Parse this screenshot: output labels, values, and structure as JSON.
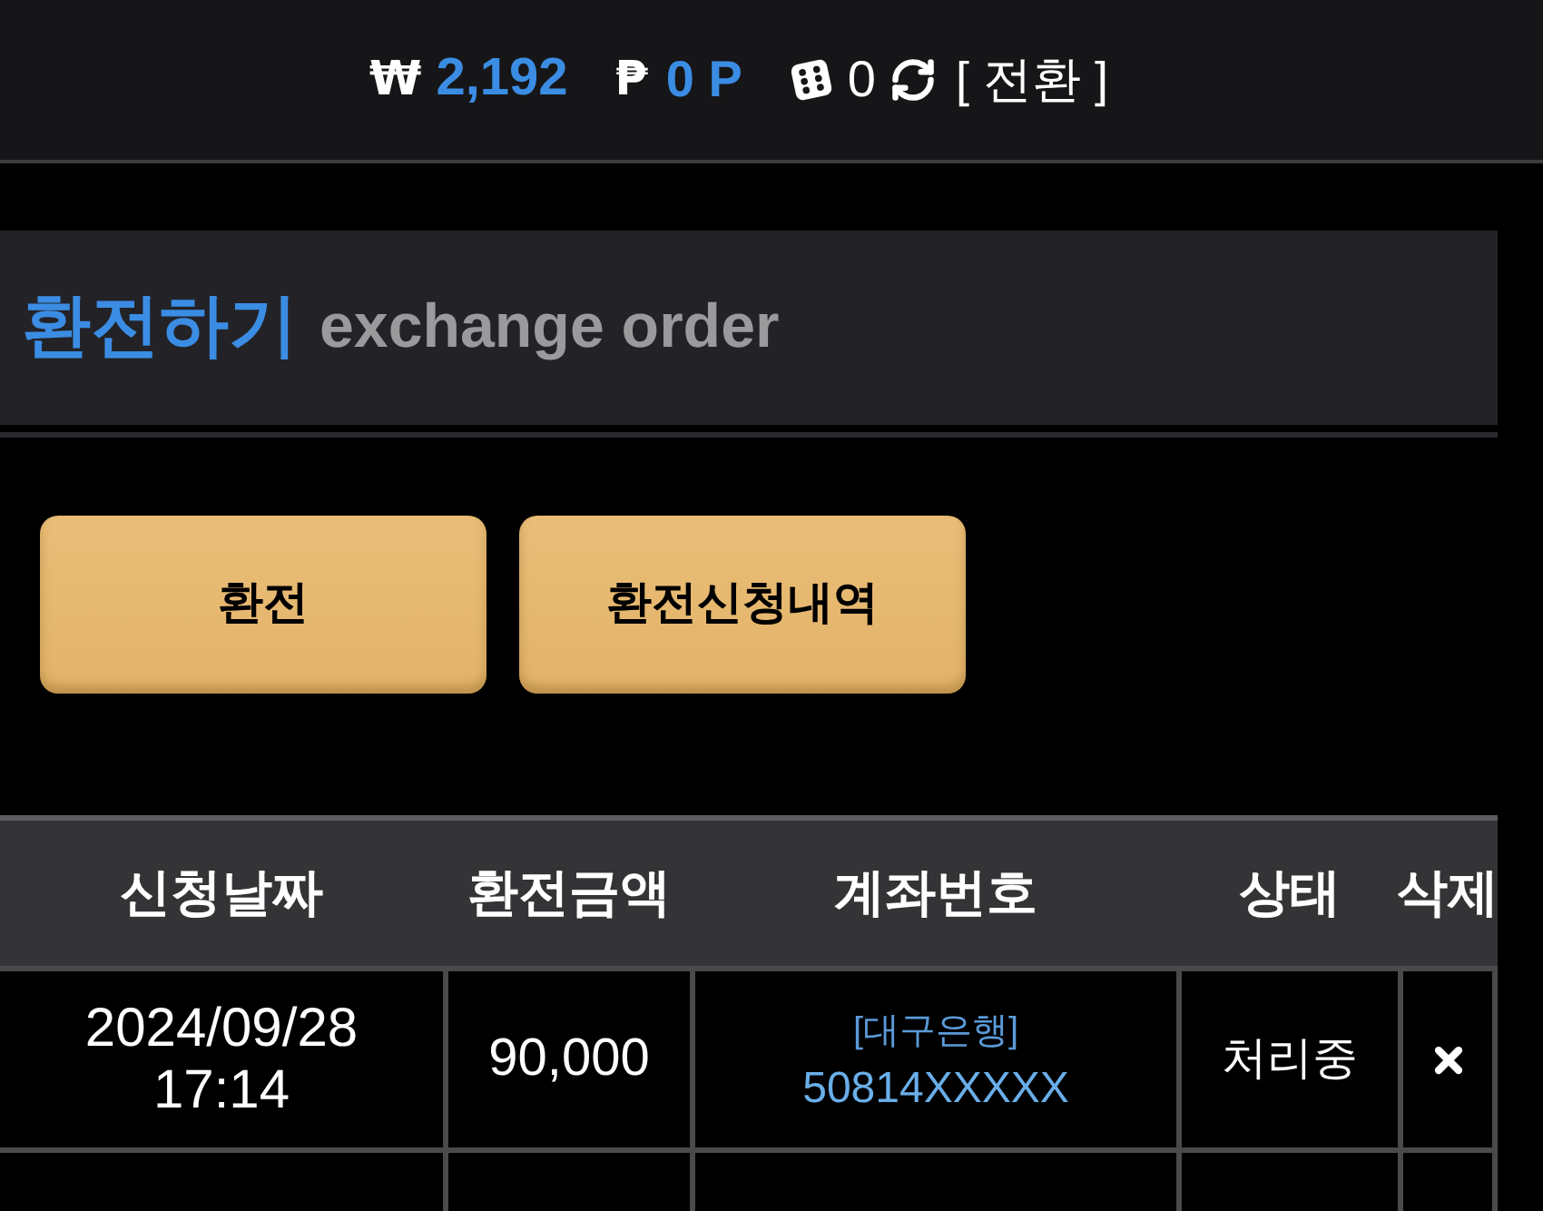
{
  "top_bar": {
    "cash": {
      "symbol": "₩",
      "amount": "2,192"
    },
    "points": {
      "symbol": "₱",
      "amount": "0 P"
    },
    "dice": {
      "count": "0"
    },
    "switch_link": "[ 전환 ]"
  },
  "section_header": {
    "title": "환전하기",
    "subtitle": "exchange order"
  },
  "buttons": [
    {
      "label": "환전"
    },
    {
      "label": "환전신청내역"
    }
  ],
  "table": {
    "columns": [
      "신청날짜",
      "환전금액",
      "계좌번호",
      "상태",
      "삭제"
    ],
    "rows": [
      {
        "date": "2024/09/28",
        "time": "17:14",
        "amount": "90,000",
        "bank": "[대구은행]",
        "account": "50814XXXXX",
        "status": "처리중"
      }
    ]
  }
}
